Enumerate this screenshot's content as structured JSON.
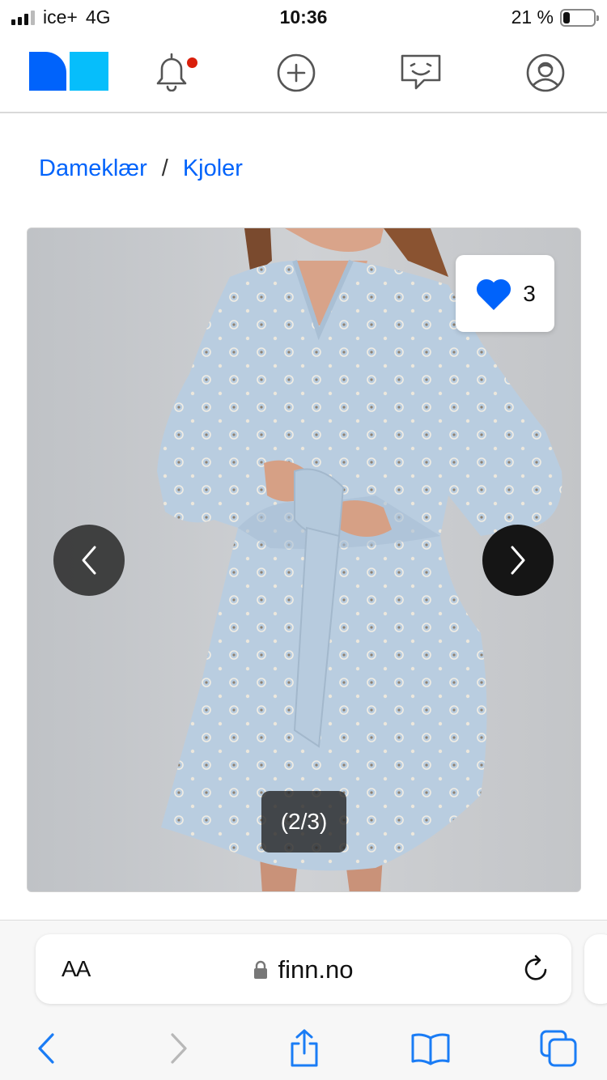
{
  "status_bar": {
    "carrier": "ice+",
    "network": "4G",
    "time": "10:36",
    "battery_percent_text": "21 %",
    "battery_level": 0.21
  },
  "header": {
    "logo": "finn-logo",
    "icons": [
      "bell-icon",
      "plus-circle-icon",
      "chat-icon",
      "profile-icon"
    ],
    "has_notification": true
  },
  "breadcrumb": {
    "items": [
      "Dameklær",
      "Kjoler"
    ],
    "separator": "/"
  },
  "gallery": {
    "favorite_count": "3",
    "counter": "(2/3)",
    "colors": {
      "heart": "#0063fb",
      "dress": "#b8cddf"
    }
  },
  "safari": {
    "text_size_label": "AA",
    "url": "finn.no"
  },
  "colors": {
    "link": "#0063fb",
    "notification": "#d91f0b",
    "ios_blue": "#1a7cf5"
  }
}
